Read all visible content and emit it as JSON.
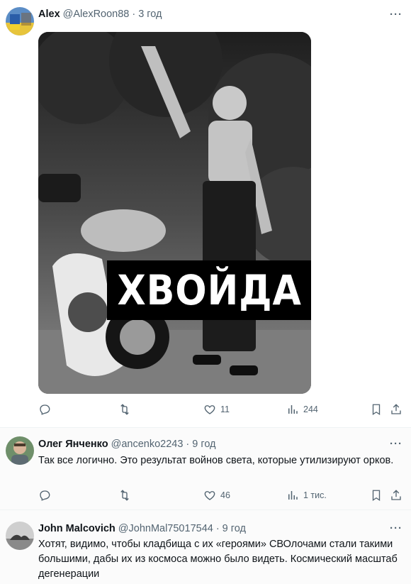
{
  "posts": [
    {
      "author": "Alex",
      "handle": "@AlexRoon88",
      "dot": "·",
      "time": "3 год",
      "image_caption": "ХВОЙДА",
      "more": "···",
      "actions": {
        "reply": "",
        "repost": "",
        "like": "11",
        "views": "244"
      }
    },
    {
      "author": "Олег Янченко",
      "handle": "@ancenko2243",
      "dot": "·",
      "time": "9 год",
      "text": "Так все логично. Это результат войнов света, которые утилизируют орков.",
      "more": "···",
      "actions": {
        "reply": "",
        "repost": "",
        "like": "46",
        "views": "1 тис."
      }
    },
    {
      "author": "John Malcovich",
      "handle": "@JohnMal75017544",
      "dot": "·",
      "time": "9 год",
      "text": "Хотят, видимо, чтобы кладбища с их «героями» СВОлочами стали такими большими, дабы их из космоса можно было видеть. Космический масштаб дегенерации",
      "more": "···"
    }
  ],
  "colors": {
    "text": "#0f1419",
    "secondary": "#536471",
    "divider": "#eff3f4"
  }
}
